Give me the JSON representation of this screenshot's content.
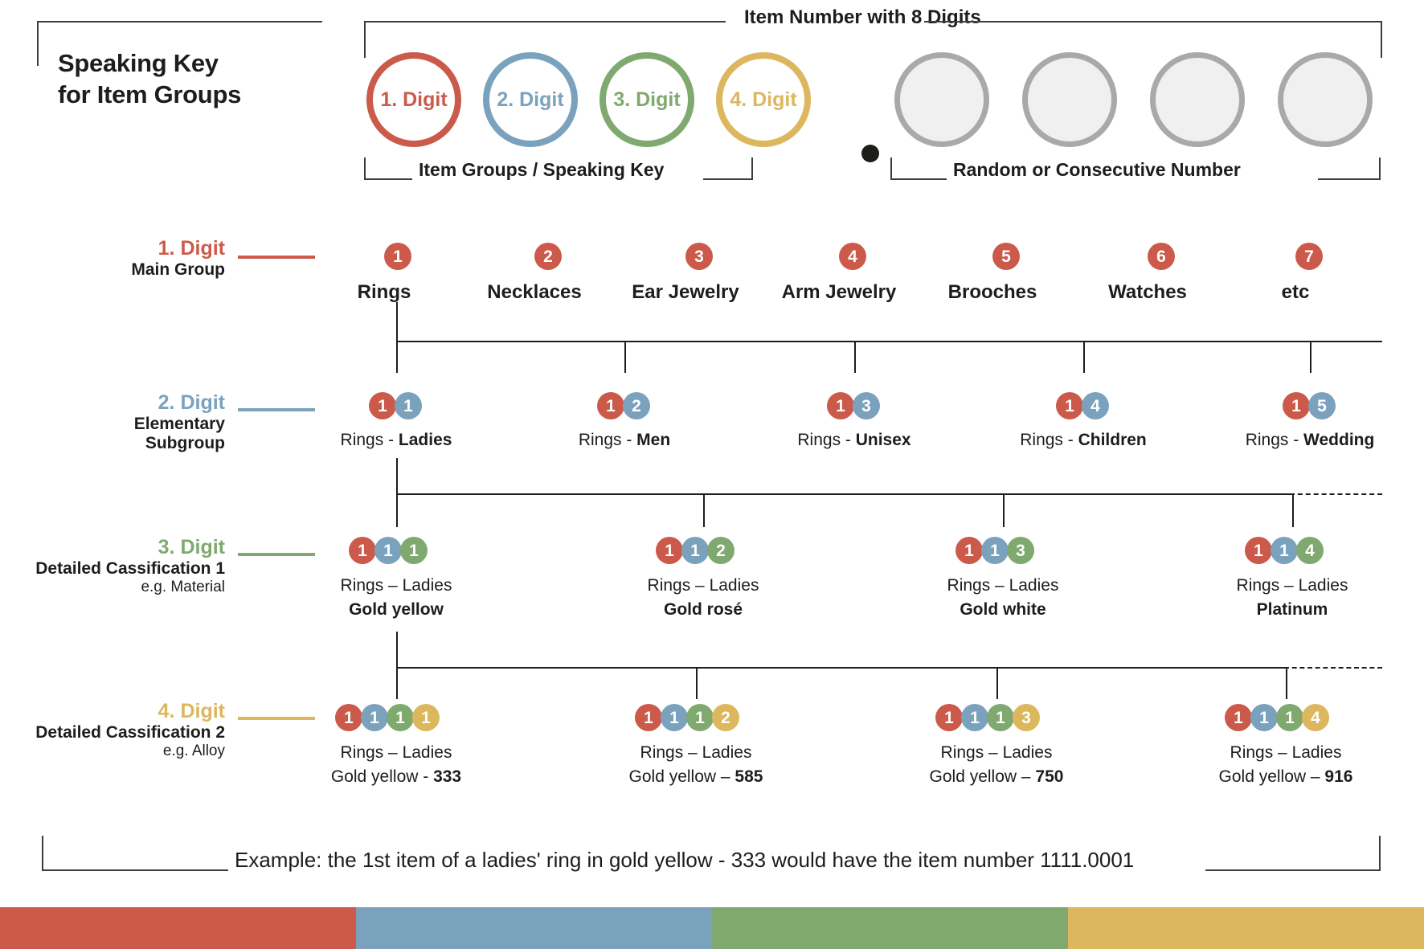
{
  "title": {
    "line1": "Speaking Key",
    "line2": "for Item Groups"
  },
  "header": {
    "item_number_label": "Item Number with 8 Digits",
    "item_groups_label": "Item Groups / Speaking Key",
    "random_label": "Random or Consecutive Number",
    "circles": [
      {
        "label": "1. Digit",
        "color": "#cb5a4b"
      },
      {
        "label": "2. Digit",
        "color": "#7ba2bd"
      },
      {
        "label": "3. Digit",
        "color": "#7fa96f"
      },
      {
        "label": "4. Digit",
        "color": "#dcb75e"
      }
    ],
    "placeholder_count": 4,
    "separator": "."
  },
  "colors": {
    "digit1": "#cb5a4b",
    "digit2": "#7ba2bd",
    "digit3": "#7fa96f",
    "digit4": "#dcb75e",
    "placeholder_fill": "#f0f0f0",
    "placeholder_stroke": "#a9a9a9",
    "text": "#1d1d1b"
  },
  "rows": [
    {
      "digit_label": "1. Digit",
      "sub_label": "Main Group",
      "sub_label2": "",
      "color": "#cb5a4b",
      "nodes": [
        {
          "codes": [
            "1"
          ],
          "caption": "Rings"
        },
        {
          "codes": [
            "2"
          ],
          "caption": "Necklaces"
        },
        {
          "codes": [
            "3"
          ],
          "caption": "Ear Jewelry"
        },
        {
          "codes": [
            "4"
          ],
          "caption": "Arm Jewelry"
        },
        {
          "codes": [
            "5"
          ],
          "caption": "Brooches"
        },
        {
          "codes": [
            "6"
          ],
          "caption": "Watches"
        },
        {
          "codes": [
            "7"
          ],
          "caption": "etc"
        }
      ]
    },
    {
      "digit_label": "2. Digit",
      "sub_label": "Elementary",
      "sub_label2": "Subgroup",
      "color": "#7ba2bd",
      "nodes": [
        {
          "codes": [
            "1",
            "1"
          ],
          "prefix": "Rings - ",
          "bold": "Ladies"
        },
        {
          "codes": [
            "1",
            "2"
          ],
          "prefix": "Rings - ",
          "bold": "Men"
        },
        {
          "codes": [
            "1",
            "3"
          ],
          "prefix": "Rings - ",
          "bold": "Unisex"
        },
        {
          "codes": [
            "1",
            "4"
          ],
          "prefix": "Rings - ",
          "bold": "Children"
        },
        {
          "codes": [
            "1",
            "5"
          ],
          "prefix": "Rings - ",
          "bold": "Wedding"
        }
      ]
    },
    {
      "digit_label": "3. Digit",
      "sub_label": "Detailed Cassification 1",
      "sub_label2": "e.g. Material",
      "color": "#7fa96f",
      "nodes": [
        {
          "codes": [
            "1",
            "1",
            "1"
          ],
          "line1": "Rings – Ladies",
          "line2_bold": "Gold yellow"
        },
        {
          "codes": [
            "1",
            "1",
            "2"
          ],
          "line1": "Rings – Ladies",
          "line2_bold": "Gold rosé"
        },
        {
          "codes": [
            "1",
            "1",
            "3"
          ],
          "line1": "Rings – Ladies",
          "line2_bold": "Gold white"
        },
        {
          "codes": [
            "1",
            "1",
            "4"
          ],
          "line1": "Rings – Ladies",
          "line2_bold": "Platinum"
        }
      ]
    },
    {
      "digit_label": "4. Digit",
      "sub_label": "Detailed Cassification 2",
      "sub_label2": "e.g. Alloy",
      "color": "#dcb75e",
      "nodes": [
        {
          "codes": [
            "1",
            "1",
            "1",
            "1"
          ],
          "line1": "Rings – Ladies",
          "line2": "Gold yellow  - ",
          "line2_bold": "333"
        },
        {
          "codes": [
            "1",
            "1",
            "1",
            "2"
          ],
          "line1": "Rings – Ladies",
          "line2": "Gold yellow – ",
          "line2_bold": "585"
        },
        {
          "codes": [
            "1",
            "1",
            "1",
            "3"
          ],
          "line1": "Rings – Ladies",
          "line2": "Gold yellow – ",
          "line2_bold": "750"
        },
        {
          "codes": [
            "1",
            "1",
            "1",
            "4"
          ],
          "line1": "Rings – Ladies",
          "line2": "Gold yellow – ",
          "line2_bold": "916"
        }
      ]
    }
  ],
  "footer": {
    "example": "Example: the 1st item of a ladies' ring in gold yellow - 333 would have the item number 1111.0001"
  },
  "colorbar": [
    "#cb5a4b",
    "#7ba2bd",
    "#7fa96f",
    "#dcb75e"
  ]
}
